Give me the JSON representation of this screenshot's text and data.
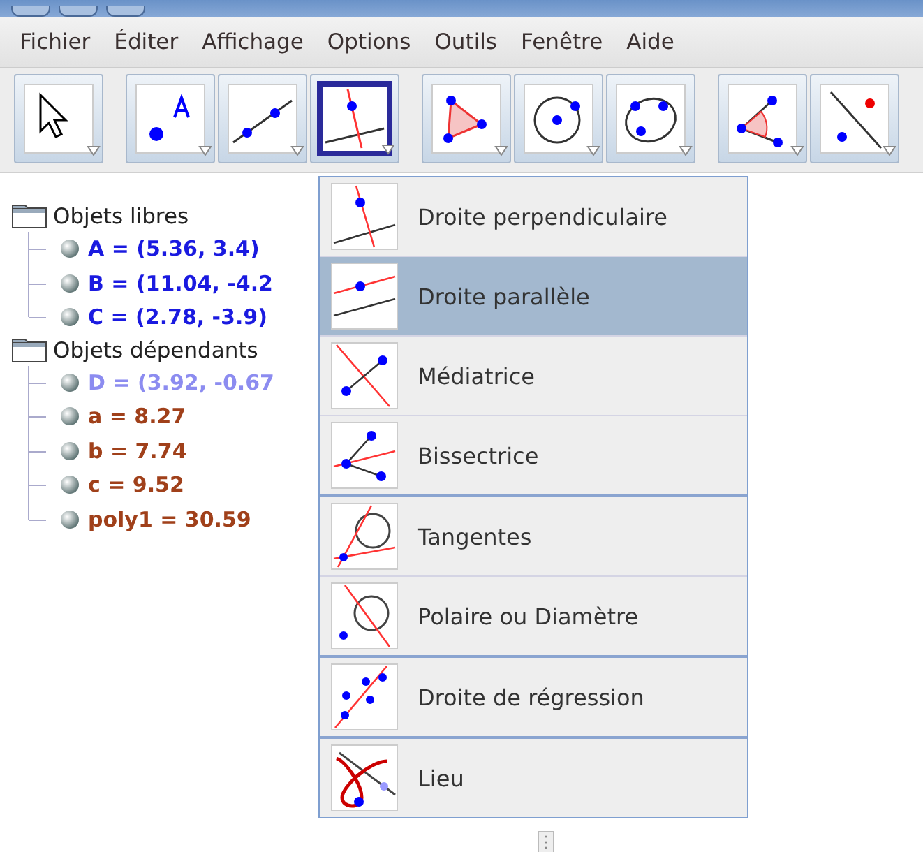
{
  "menu_bar": [
    "Fichier",
    "Éditer",
    "Affichage",
    "Options",
    "Outils",
    "Fenêtre",
    "Aide"
  ],
  "toolbar": {
    "groups": [
      {
        "tools": [
          {
            "kind": "move",
            "selected": false
          }
        ]
      },
      {
        "tools": [
          {
            "kind": "point",
            "selected": false
          },
          {
            "kind": "line",
            "selected": false
          },
          {
            "kind": "perpendicular",
            "selected": true
          }
        ]
      },
      {
        "tools": [
          {
            "kind": "polygon",
            "selected": false
          },
          {
            "kind": "circle",
            "selected": false
          },
          {
            "kind": "conic",
            "selected": false
          }
        ]
      },
      {
        "tools": [
          {
            "kind": "angle",
            "selected": false
          },
          {
            "kind": "reflect",
            "selected": false
          }
        ]
      }
    ]
  },
  "algebra_tree": [
    {
      "label": "Objets libres",
      "children": [
        {
          "text": "A = (5.36, 3.4)",
          "color": "#1a1ae0"
        },
        {
          "text": "B = (11.04, -4.2",
          "color": "#1a1ae0"
        },
        {
          "text": "C = (2.78, -3.9)",
          "color": "#1a1ae0"
        }
      ]
    },
    {
      "label": "Objets dépendants",
      "children": [
        {
          "text": "D = (3.92, -0.67",
          "color": "#8c8cf0"
        },
        {
          "text": "a = 8.27",
          "color": "#a0401a"
        },
        {
          "text": "b = 7.74",
          "color": "#a0401a"
        },
        {
          "text": "c = 9.52",
          "color": "#a0401a"
        },
        {
          "text": "poly1 = 30.59",
          "color": "#a0401a"
        }
      ]
    }
  ],
  "popup_menu": {
    "groups": [
      {
        "items": [
          {
            "kind": "perpendicular",
            "label": "Droite perpendiculaire",
            "selected": false
          },
          {
            "kind": "parallel",
            "label": "Droite parallèle",
            "selected": true
          },
          {
            "kind": "perp_bisector",
            "label": "Médiatrice",
            "selected": false
          },
          {
            "kind": "angle_bisector",
            "label": "Bissectrice",
            "selected": false
          }
        ]
      },
      {
        "items": [
          {
            "kind": "tangents",
            "label": "Tangentes",
            "selected": false
          },
          {
            "kind": "polar",
            "label": "Polaire ou Diamètre",
            "selected": false
          }
        ]
      },
      {
        "items": [
          {
            "kind": "regression",
            "label": "Droite de régression",
            "selected": false
          }
        ]
      },
      {
        "items": [
          {
            "kind": "locus",
            "label": "Lieu",
            "selected": false
          }
        ]
      }
    ]
  }
}
